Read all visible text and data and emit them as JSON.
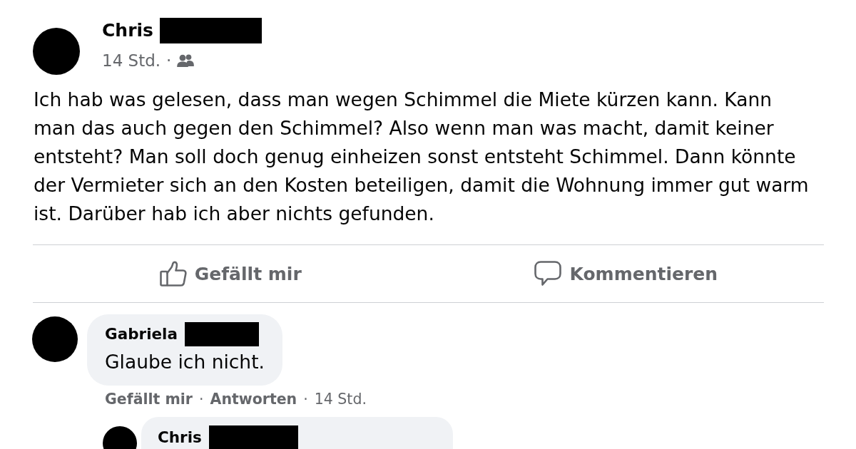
{
  "post": {
    "author": {
      "name": "Chris",
      "redacted": true
    },
    "time": "14 Std.",
    "separator": "·",
    "text": "Ich hab was gelesen, dass man wegen Schimmel die Miete kürzen kann. Kann man das auch gegen den Schimmel? Also wenn man was macht, damit keiner entsteht? Man soll doch genug einheizen sonst entsteht Schimmel. Dann könnte der Vermieter sich an den Kosten beteiligen, damit die Wohnung immer gut warm ist. Darüber hab ich aber nichts gefunden.",
    "actions": [
      {
        "kind": "like",
        "label": "Gefällt mir"
      },
      {
        "kind": "comment",
        "label": "Kommentieren"
      }
    ]
  },
  "comments": [
    {
      "author": {
        "name": "Gabriela",
        "redacted": true
      },
      "text": "Glaube ich nicht.",
      "footer": [
        {
          "kind": "like",
          "text": "Gefällt mir"
        },
        {
          "kind": "dot",
          "text": "·"
        },
        {
          "kind": "reply",
          "text": "Antworten"
        },
        {
          "kind": "dot",
          "text": "·"
        },
        {
          "kind": "time",
          "text": "14 Std."
        }
      ],
      "replies": [
        {
          "author": {
            "name": "Chris",
            "redacted": true
          }
        }
      ]
    }
  ]
}
